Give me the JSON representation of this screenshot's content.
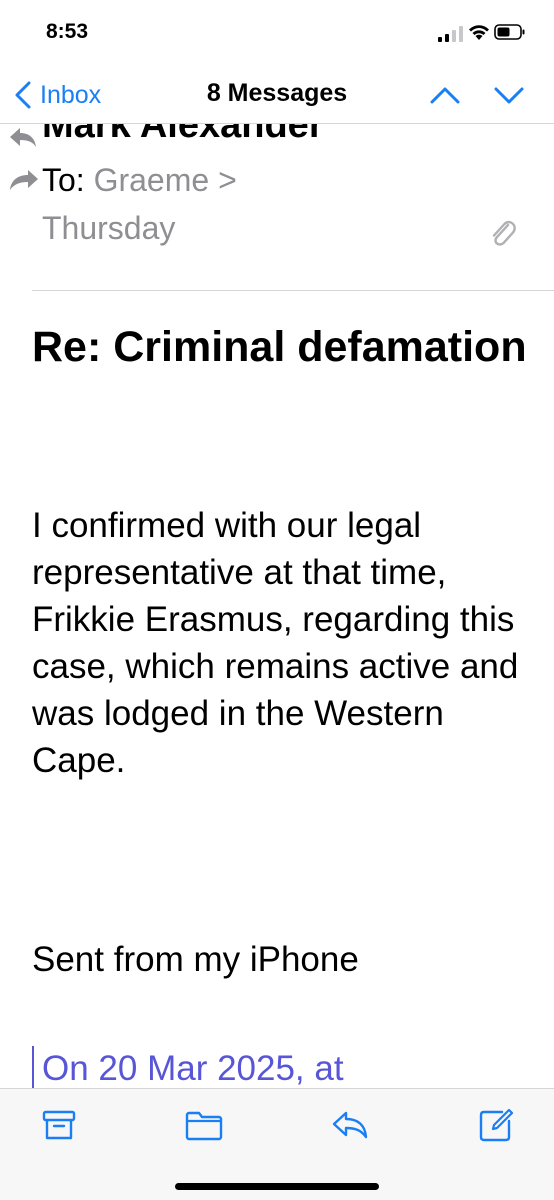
{
  "status_bar": {
    "time": "8:53"
  },
  "nav": {
    "back_label": "Inbox",
    "title": "8 Messages"
  },
  "message": {
    "sender": "Mark Alexander",
    "to_label": "To:",
    "to_name": "Graeme >",
    "date": "Thursday",
    "subject": "Re: Criminal defamation",
    "body": " I confirmed with our legal representative at that time, Frikkie Erasmus, regarding this case, which remains active and was lodged in the Western Cape.",
    "signature": "Sent from my iPhone",
    "quote_preview": "On 20 Mar 2025, at"
  },
  "colors": {
    "accent": "#1a7ff5",
    "secondary_text": "#8e8e93",
    "quote": "#5856d6"
  },
  "icons": {
    "reply_indicator": "reply-icon",
    "forward_indicator": "forward-icon",
    "attachment": "paperclip-icon",
    "toolbar": [
      "archive-icon",
      "folder-icon",
      "reply-icon",
      "compose-icon"
    ]
  }
}
